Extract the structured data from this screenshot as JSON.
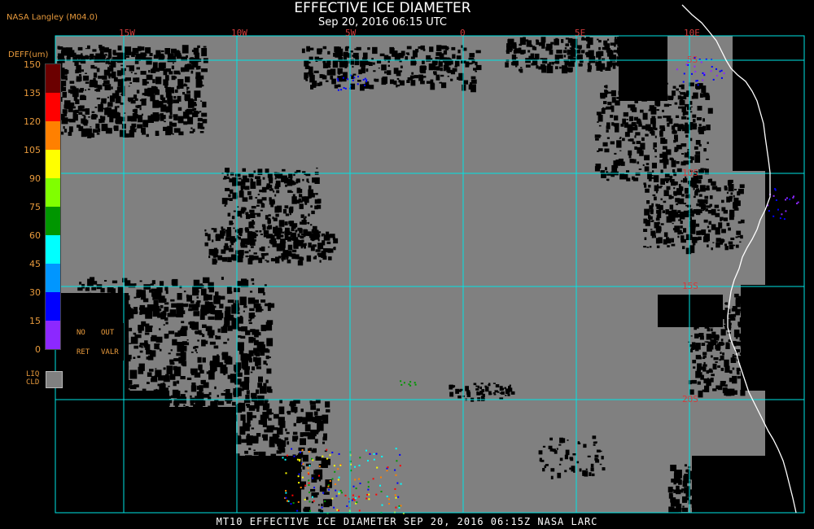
{
  "header": {
    "title": "EFFECTIVE ICE DIAMETER",
    "subtitle": "Sep 20, 2016 06:15 UTC",
    "producer": "NASA Langley (M04.0)"
  },
  "footer": {
    "caption": "MT10  EFFECTIVE ICE DIAMETER  SEP 20, 2016 06:15Z  NASA LARC"
  },
  "map": {
    "longitude_labels": [
      "15W",
      "10W",
      "5W",
      "0",
      "5E",
      "10E"
    ],
    "latitude_labels": [
      "5S",
      "10S",
      "15S",
      "20S"
    ],
    "colors": {
      "background_cloud": "#808080",
      "clear": "#000000",
      "grid": "#00e5e5",
      "coastline": "#ffffff",
      "grid_label": "#d23c3c"
    }
  },
  "legend": {
    "title": "DEFF(um)",
    "ticks": [
      "150",
      "135",
      "120",
      "105",
      "90",
      "75",
      "60",
      "45",
      "30",
      "15",
      "0"
    ],
    "colors": [
      "#6b0000",
      "#ff0000",
      "#ff8000",
      "#ffff00",
      "#80ff00",
      "#009600",
      "#00ffff",
      "#0096ff",
      "#0000ff",
      "#8c28ff"
    ],
    "flags": {
      "no": "NO",
      "out": "OUT",
      "ret": "RET",
      "valr": "VALR"
    },
    "liq_label_line1": "LIQ",
    "liq_label_line2": "CLD",
    "liq_color": "#808080"
  }
}
